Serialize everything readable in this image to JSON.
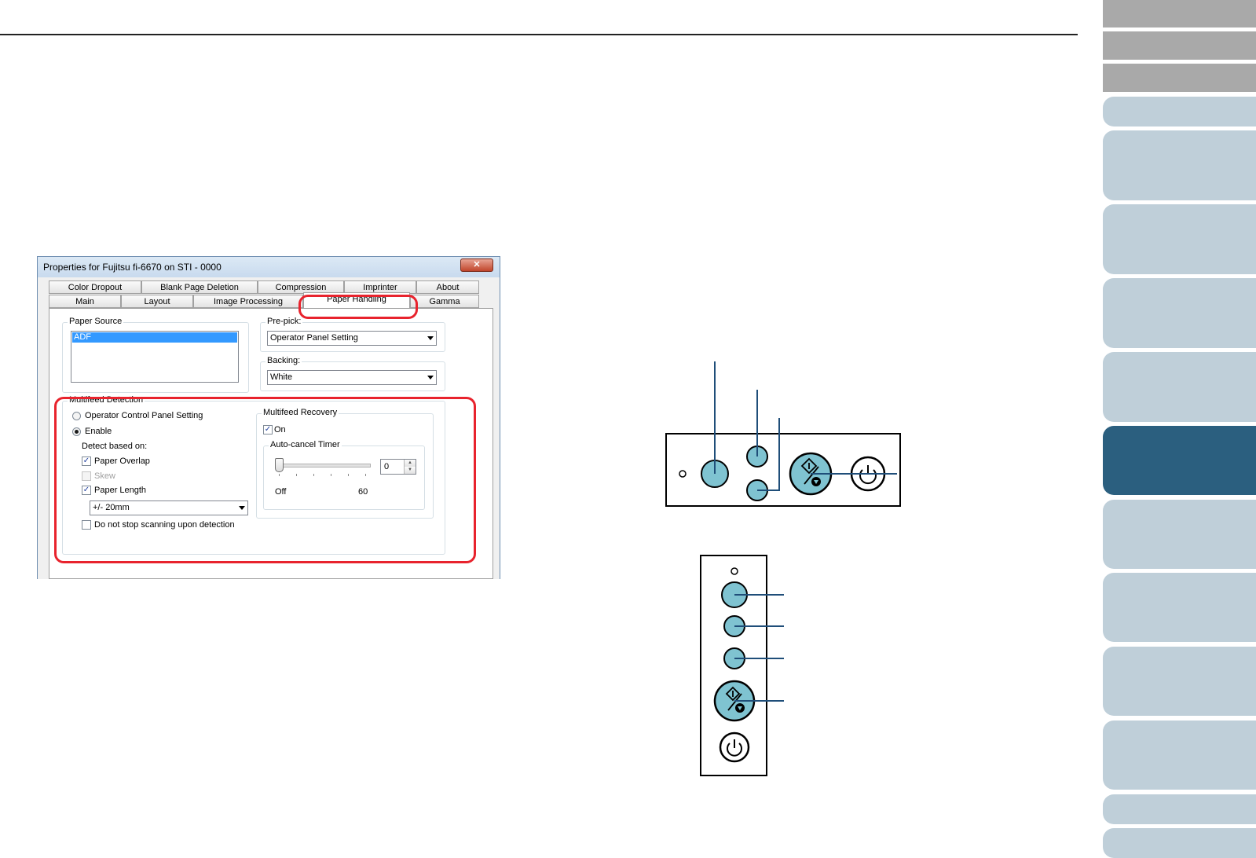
{
  "dialog": {
    "title": "Properties for Fujitsu fi-6670 on STI - 0000",
    "close_glyph": "✕",
    "tabs_row1": [
      "Color Dropout",
      "Blank Page Deletion",
      "Compression",
      "Imprinter",
      "About"
    ],
    "tabs_row2": [
      "Main",
      "Layout",
      "Image Processing",
      "Paper Handling",
      "Gamma"
    ],
    "active_tab": "Paper Handling",
    "paper_source": {
      "legend": "Paper Source",
      "selected_item": "ADF"
    },
    "pre_pick": {
      "label": "Pre-pick:",
      "value": "Operator Panel Setting"
    },
    "backing": {
      "label": "Backing:",
      "value": "White"
    },
    "multifeed_detection": {
      "legend": "Multifeed Detection",
      "option_operator": "Operator Control Panel Setting",
      "option_enable": "Enable",
      "detect_based_on": "Detect based on:",
      "paper_overlap": "Paper Overlap",
      "skew": "Skew",
      "paper_length": "Paper Length",
      "length_value": "+/- 20mm",
      "do_not_stop": "Do not stop scanning upon detection"
    },
    "multifeed_recovery": {
      "legend": "Multifeed Recovery",
      "on_label": "On",
      "timer_legend": "Auto-cancel Timer",
      "slider_min": "Off",
      "slider_max": "60",
      "timer_value": "0"
    }
  },
  "colors": {
    "accent_red": "#e8232d",
    "button_fill": "#7fc3d1",
    "leader_line": "#1f4e79",
    "nav_active": "#2b5f7f",
    "nav_light": "#bfcfd9",
    "nav_gray": "#a9a9a9"
  },
  "icons": [
    "close-icon",
    "scan-stop-icon",
    "power-icon",
    "dropdown-arrow-icon",
    "checkmark-icon"
  ]
}
